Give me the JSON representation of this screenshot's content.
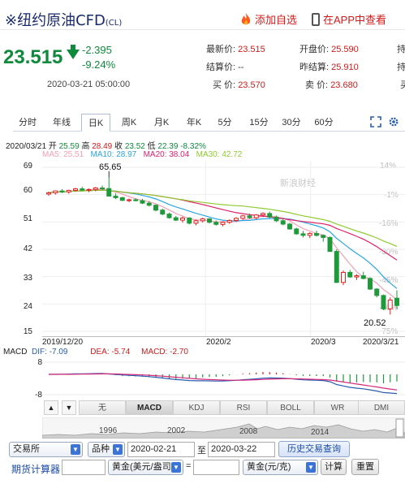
{
  "header": {
    "title_prefix": "※",
    "title": "纽约原油CFD",
    "title_code": "(CL)",
    "add_favorite": "添加自选",
    "open_app": "在APP中查看"
  },
  "quote": {
    "price": "23.515",
    "change": "-2.395",
    "change_pct": "-9.24%",
    "datetime": "2020-03-21 05:00:00",
    "fields": [
      {
        "label": "最新价:",
        "value": "23.515"
      },
      {
        "label": "开盘价:",
        "value": "25.590"
      },
      {
        "label": "持",
        "value": ""
      },
      {
        "label": "结算价:",
        "value": "--"
      },
      {
        "label": "昨结算:",
        "value": "25.910"
      },
      {
        "label": "持",
        "value": ""
      },
      {
        "label": "买  价:",
        "value": "23.570"
      },
      {
        "label": "卖  价:",
        "value": "23.680"
      },
      {
        "label": "买",
        "value": ""
      }
    ]
  },
  "tabs": [
    "分时",
    "年线",
    "日K",
    "周K",
    "月K",
    "年K",
    "5分",
    "15分",
    "30分",
    "60分"
  ],
  "active_tab": "日K",
  "info": {
    "date": "2020/03/21",
    "open_label": "开",
    "open": "25.59",
    "high_label": "高",
    "high": "28.49",
    "close_label": "收",
    "close": "23.52",
    "low_label": "低",
    "low": "22.39",
    "pct": "-8.32%"
  },
  "ma": [
    {
      "label": "MA5:",
      "value": "25.51",
      "color": "#f4a0b4"
    },
    {
      "label": "MA10:",
      "value": "28.97",
      "color": "#2aa6e6"
    },
    {
      "label": "MA20:",
      "value": "38.04",
      "color": "#e0206a"
    },
    {
      "label": "MA30:",
      "value": "42.72",
      "color": "#8ecb2f"
    }
  ],
  "watermark": "新浪财经",
  "chart_data": {
    "type": "candlestick",
    "y_ticks": [
      "69",
      "60",
      "51",
      "42",
      "33",
      "24",
      "15"
    ],
    "y_right_ticks": [
      "14%",
      "-1%",
      "-16%",
      "-30%",
      "-45%",
      "-60%",
      "-75%"
    ],
    "x_ticks": [
      "2019/12/20",
      "2020/2",
      "2020/3",
      "2020/3/21"
    ],
    "annotations": {
      "high": "65.65",
      "low": "20.52",
      "date_label": "2020/2"
    },
    "ylim": [
      15,
      69
    ],
    "candles": [
      [
        60.2,
        61.0,
        59.6,
        60.6
      ],
      [
        60.6,
        61.4,
        60.0,
        61.2
      ],
      [
        61.2,
        61.8,
        60.5,
        60.9
      ],
      [
        60.9,
        61.6,
        60.3,
        61.4
      ],
      [
        61.4,
        62.2,
        61.0,
        61.9
      ],
      [
        61.9,
        62.6,
        61.2,
        61.5
      ],
      [
        61.5,
        62.0,
        60.8,
        61.7
      ],
      [
        61.7,
        62.5,
        61.1,
        62.2
      ],
      [
        62.2,
        63.0,
        61.5,
        62.0
      ],
      [
        62.0,
        65.6,
        59.8,
        59.5
      ],
      [
        59.5,
        60.4,
        58.5,
        59.0
      ],
      [
        59.0,
        59.3,
        57.9,
        58.1
      ],
      [
        58.1,
        58.7,
        57.5,
        58.3
      ],
      [
        58.3,
        58.8,
        57.8,
        58.0
      ],
      [
        58.0,
        58.6,
        56.9,
        57.2
      ],
      [
        57.2,
        57.9,
        56.1,
        56.5
      ],
      [
        56.5,
        56.8,
        54.5,
        54.9
      ],
      [
        54.9,
        55.4,
        53.2,
        53.6
      ],
      [
        53.6,
        54.1,
        52.1,
        52.4
      ],
      [
        52.4,
        53.0,
        51.3,
        51.6
      ],
      [
        51.6,
        52.8,
        50.8,
        52.3
      ],
      [
        52.3,
        52.6,
        50.2,
        50.6
      ],
      [
        50.6,
        51.8,
        49.9,
        51.4
      ],
      [
        51.4,
        52.4,
        50.8,
        52.0
      ],
      [
        52.0,
        52.3,
        50.5,
        50.9
      ],
      [
        50.9,
        51.5,
        49.8,
        50.2
      ],
      [
        50.2,
        51.2,
        49.6,
        50.9
      ],
      [
        50.9,
        51.9,
        50.4,
        51.5
      ],
      [
        51.5,
        52.6,
        51.0,
        52.2
      ],
      [
        52.2,
        53.3,
        51.7,
        53.0
      ],
      [
        53.0,
        53.8,
        52.1,
        52.4
      ],
      [
        52.4,
        53.6,
        51.8,
        53.3
      ],
      [
        53.3,
        54.2,
        52.6,
        53.8
      ],
      [
        53.8,
        54.4,
        52.2,
        52.6
      ],
      [
        52.6,
        53.1,
        51.0,
        51.4
      ],
      [
        51.4,
        52.0,
        49.9,
        50.3
      ],
      [
        50.3,
        50.7,
        48.4,
        48.7
      ],
      [
        48.7,
        49.1,
        46.8,
        47.1
      ],
      [
        47.1,
        48.0,
        45.9,
        46.6
      ],
      [
        46.6,
        47.6,
        45.7,
        47.2
      ],
      [
        47.2,
        48.1,
        46.2,
        46.6
      ],
      [
        46.6,
        46.9,
        44.5,
        45.9
      ],
      [
        45.9,
        46.2,
        43.2,
        41.3
      ],
      [
        41.3,
        42.0,
        30.9,
        31.1
      ],
      [
        31.1,
        35.0,
        30.2,
        34.4
      ],
      [
        34.4,
        35.2,
        32.6,
        32.9
      ],
      [
        32.9,
        33.8,
        31.9,
        33.3
      ],
      [
        33.3,
        34.6,
        32.1,
        32.4
      ],
      [
        32.4,
        32.8,
        28.6,
        28.9
      ],
      [
        28.9,
        29.2,
        26.2,
        26.8
      ],
      [
        26.8,
        27.1,
        22.0,
        22.4
      ],
      [
        22.4,
        26.2,
        20.5,
        25.3
      ],
      [
        25.9,
        28.5,
        22.4,
        23.5
      ]
    ]
  },
  "macd": {
    "label": "MACD",
    "dif_label": "DIF:",
    "dif": "-7.09",
    "dea_label": "DEA:",
    "dea": "-5.74",
    "macd_label": "MACD:",
    "macd_val": "-2.70",
    "y_ticks": [
      "8",
      "-8"
    ]
  },
  "indicator_tabs": [
    "无",
    "MACD",
    "KDJ",
    "RSI",
    "BOLL",
    "WR",
    "DMI"
  ],
  "active_indicator": "MACD",
  "timeline_years": [
    "1996",
    "2002",
    "2008",
    "2014"
  ],
  "form": {
    "exchange": "交易所",
    "variety": "品种",
    "date_from": "2020-02-21",
    "to_label": "至",
    "date_to": "2020-03-22",
    "history_button": "历史交易查询",
    "calculator_label": "期货计算器",
    "unit_left": "黄金(美元/盎司",
    "equals": "=",
    "unit_right": "黄金(元/克)",
    "calc_button": "计算",
    "reset_button": "重置"
  }
}
